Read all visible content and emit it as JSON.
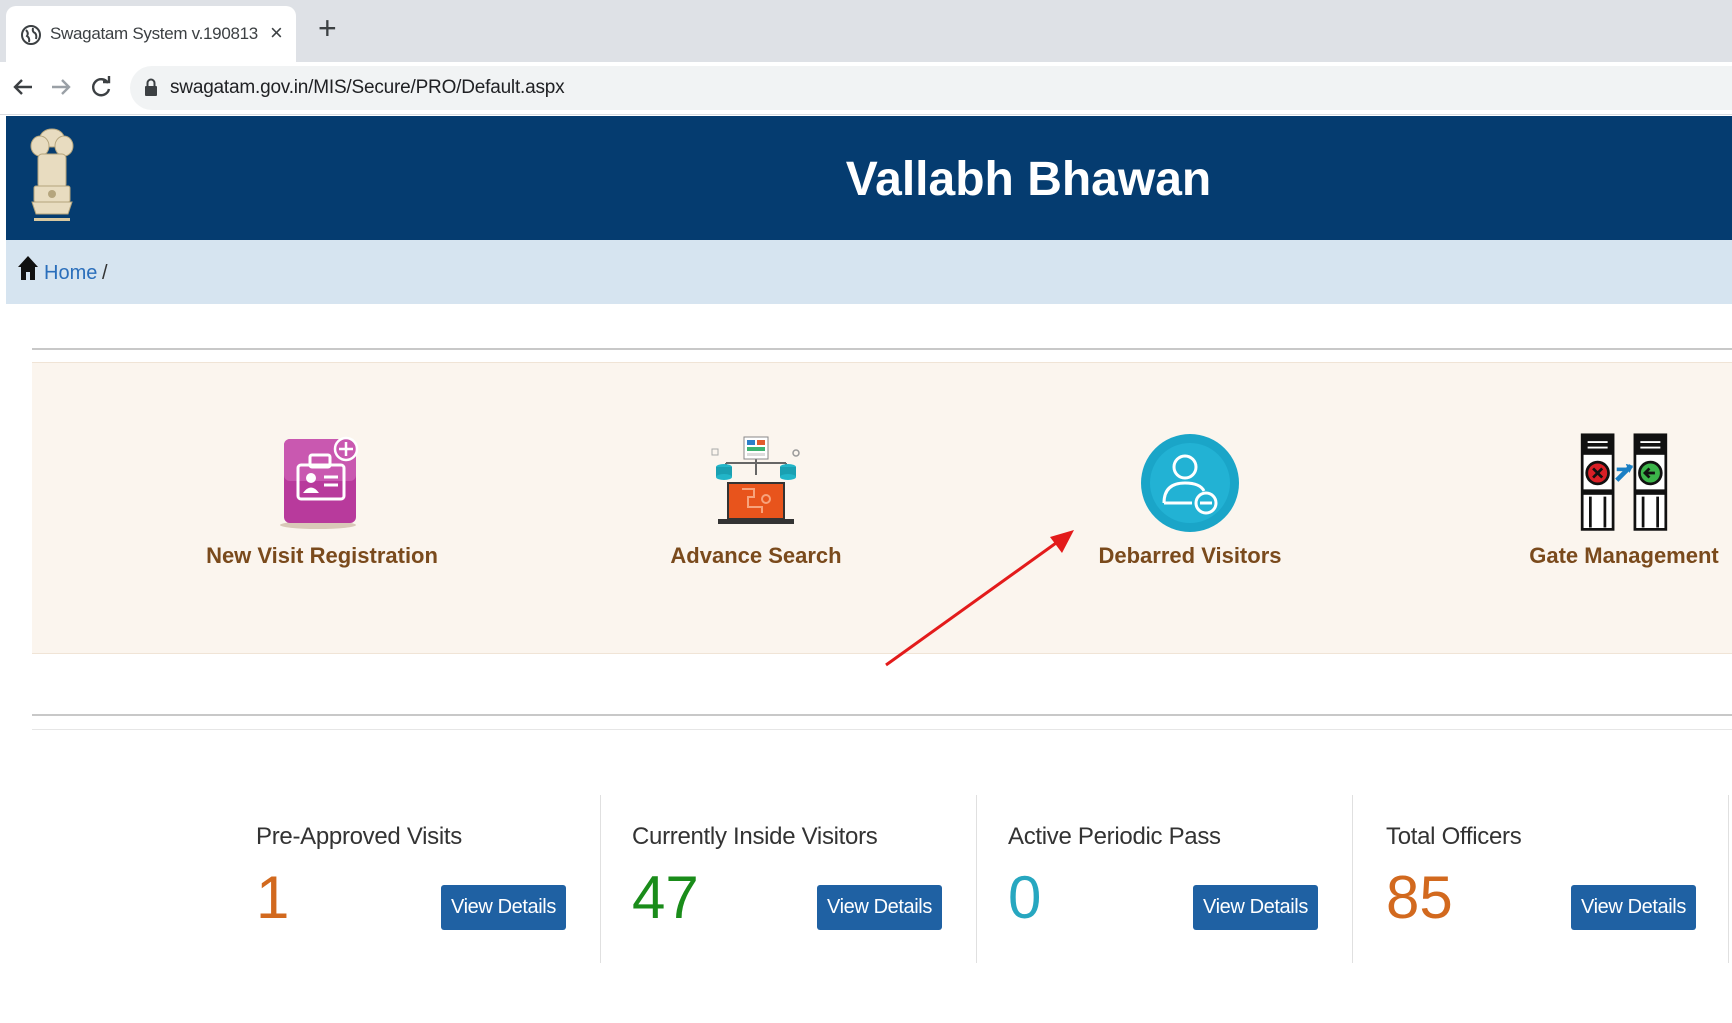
{
  "browser": {
    "tab_title": "Swagatam System v.190813",
    "tab_close": "×",
    "new_tab": "+",
    "url": "swagatam.gov.in/MIS/Secure/PRO/Default.aspx"
  },
  "header": {
    "title": "Vallabh Bhawan",
    "background_color": "#053c70"
  },
  "breadcrumb": {
    "home_label": "Home",
    "separator": "/"
  },
  "quick_links": [
    {
      "label": "New Visit Registration",
      "icon": "visit-registration-icon"
    },
    {
      "label": "Advance Search",
      "icon": "advance-search-icon"
    },
    {
      "label": "Debarred Visitors",
      "icon": "debarred-visitors-icon"
    },
    {
      "label": "Gate Management",
      "icon": "gate-management-icon"
    }
  ],
  "stats": [
    {
      "label": "Pre-Approved Visits",
      "value": "1",
      "value_color": "#d2691e",
      "button": "View Details"
    },
    {
      "label": "Currently Inside Visitors",
      "value": "47",
      "value_color": "#1a8c1a",
      "button": "View Details"
    },
    {
      "label": "Active Periodic Pass",
      "value": "0",
      "value_color": "#27a7c0",
      "button": "View Details"
    },
    {
      "label": "Total Officers",
      "value": "85",
      "value_color": "#d2691e",
      "button": "View Details"
    }
  ],
  "colors": {
    "accent_button": "#1f61a3",
    "annotation_arrow": "#e31b1b"
  }
}
